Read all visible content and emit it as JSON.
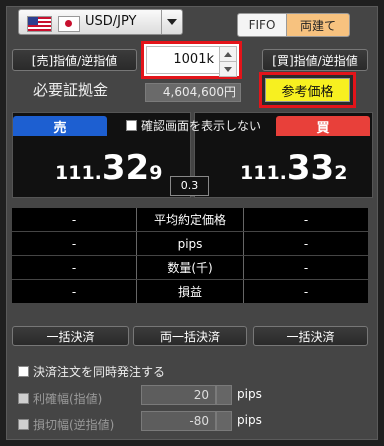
{
  "pair": {
    "label": "USD/JPY"
  },
  "mode": {
    "fifo": "FIFO",
    "both": "両建て"
  },
  "order_buttons": {
    "sell": "[売]指値/逆指値",
    "buy": "[買]指値/逆指値"
  },
  "quantity": {
    "value": "1001k"
  },
  "margin": {
    "label": "必要証拠金",
    "value": "4,604,600円"
  },
  "reference_price_label": "参考価格",
  "confirm_label": "確認画面を表示しない",
  "sell": {
    "tab": "売",
    "price_prefix": "111.",
    "price_main": "32",
    "price_suffix": "9"
  },
  "buy": {
    "tab": "買",
    "price_prefix": "111.",
    "price_main": "33",
    "price_suffix": "2"
  },
  "spread": "0.3",
  "info_rows": [
    {
      "sell": "-",
      "label": "平均約定価格",
      "buy": "-"
    },
    {
      "sell": "-",
      "label": "pips",
      "buy": "-"
    },
    {
      "sell": "-",
      "label": "数量(千)",
      "buy": "-"
    },
    {
      "sell": "-",
      "label": "損益",
      "buy": "-"
    }
  ],
  "settle_buttons": {
    "sell": "一括決済",
    "both": "両一括決済",
    "buy": "一括決済"
  },
  "simultaneous_label": "決済注文を同時発注する",
  "take_profit": {
    "label": "利確幅(指値)",
    "value": "20",
    "unit": "pips"
  },
  "stop_loss": {
    "label": "損切幅(逆指値)",
    "value": "-80",
    "unit": "pips"
  },
  "colors": {
    "sell": "#1d5fd1",
    "buy": "#e8403a",
    "highlight": "#e3141a",
    "reference": "#f7f020"
  }
}
